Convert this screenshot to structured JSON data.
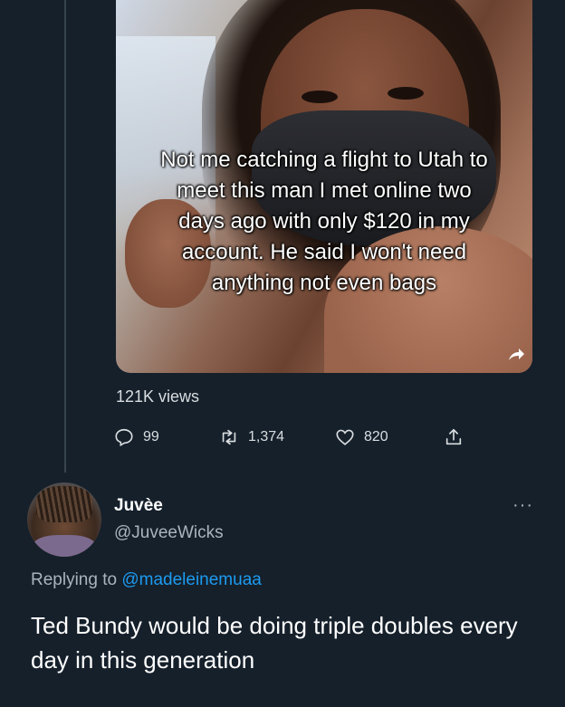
{
  "quoted_tweet": {
    "video_overlay_text": "Not me catching a flight to Utah to meet this man I met online two days ago with only $120 in my account. He said I won't need anything not even bags",
    "views": "121K views",
    "actions": {
      "replies": "99",
      "retweets": "1,374",
      "likes": "820"
    }
  },
  "reply_tweet": {
    "display_name": "Juvèe",
    "handle": "@JuveeWicks",
    "replying_prefix": "Replying to",
    "replying_to": "@madeleinemuaa",
    "text": "Ted Bundy would be doing triple doubles every day in this generation"
  },
  "icons": {
    "reply": "reply-icon",
    "retweet": "retweet-icon",
    "like": "heart-icon",
    "share": "share-icon",
    "more": "more-icon"
  },
  "colors": {
    "background": "#15202b",
    "text_primary": "#ffffff",
    "text_secondary": "#a9b4bd",
    "link": "#1d9bf0"
  }
}
